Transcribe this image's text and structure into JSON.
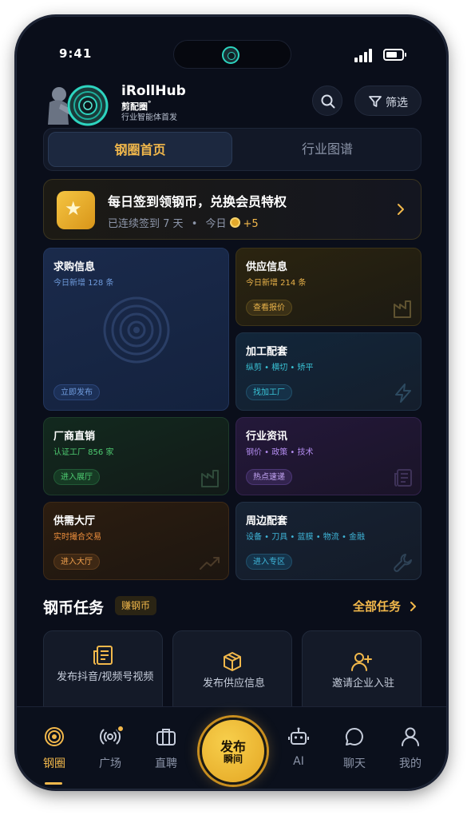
{
  "status_bar": {
    "time": "9:41"
  },
  "header": {
    "app_name": "iRollHub",
    "sub_name": "剪配圈",
    "sub_mark": "°",
    "tagline": "行业智能体首发",
    "filter_label": "筛选",
    "icons": {
      "search": "search-icon",
      "filter": "filter-icon"
    }
  },
  "tabs": [
    {
      "label": "钢圈首页",
      "active": true
    },
    {
      "label": "行业图谱",
      "active": false
    }
  ],
  "signin": {
    "title": "每日签到领钢币，兑换会员特权",
    "streak_text": "已连续签到 7 天",
    "separator": "•",
    "today_label": "今日",
    "reward": "+5"
  },
  "cards": {
    "qiugou": {
      "title": "求购信息",
      "subtitle": "今日新增 128 条",
      "chip": "立即发布",
      "accent": "#5b8bd6"
    },
    "gongying": {
      "title": "供应信息",
      "subtitle": "今日新增 214 条",
      "chip": "查看报价",
      "accent": "#e8b24a"
    },
    "jiagong": {
      "title": "加工配套",
      "subtitle": "纵剪 • 横切 • 矫平",
      "chip": "找加工厂",
      "accent": "#39c3d6"
    },
    "changshang": {
      "title": "厂商直销",
      "subtitle": "认证工厂 856 家",
      "chip": "进入展厅",
      "accent": "#4ecb71"
    },
    "zixun": {
      "title": "行业资讯",
      "subtitle": "钢价 • 政策 • 技术",
      "chip": "热点速递",
      "accent": "#b38cf0"
    },
    "gongxu": {
      "title": "供需大厅",
      "subtitle": "实时撮合交易",
      "chip": "进入大厅",
      "accent": "#f0903d"
    },
    "zhoubian": {
      "title": "周边配套",
      "subtitle": "设备 • 刀具 • 蓝膜 • 物流 • 金融",
      "chip": "进入专区",
      "accent": "#3fb6d9"
    }
  },
  "tasks": {
    "title": "钢币任务",
    "badge": "赚钢币",
    "all_label": "全部任务",
    "items": [
      {
        "label": "发布抖音/视频号视频",
        "icon": "document-icon"
      },
      {
        "label": "发布供应信息",
        "icon": "box-icon"
      },
      {
        "label": "邀请企业入驻",
        "icon": "add-user-icon"
      }
    ]
  },
  "nav": {
    "items": [
      {
        "label": "钢圈",
        "active": true,
        "icon": "ring-icon"
      },
      {
        "label": "广场",
        "active": false,
        "icon": "broadcast-icon"
      },
      {
        "label": "直聘",
        "active": false,
        "icon": "briefcase-icon"
      },
      {
        "label": "AI",
        "active": false,
        "icon": "robot-icon"
      },
      {
        "label": "聊天",
        "active": false,
        "icon": "chat-icon"
      },
      {
        "label": "我的",
        "active": false,
        "icon": "user-icon"
      }
    ],
    "publish_label_1": "发布",
    "publish_label_2": "瞬间"
  },
  "colors": {
    "accent": "#f2b84b",
    "background": "#0a0e1a"
  }
}
